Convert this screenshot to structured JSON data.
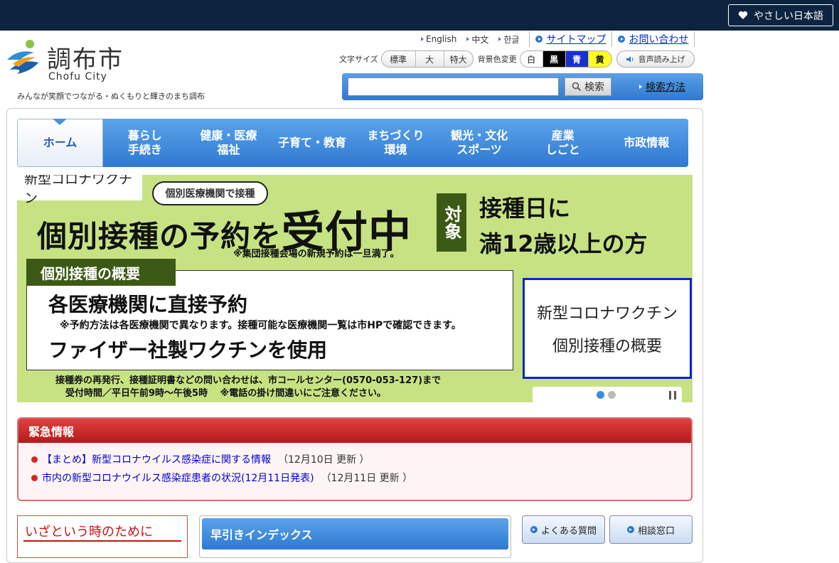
{
  "topbar": {
    "easy_japanese": "やさしい日本語"
  },
  "header": {
    "site_name": "調布市",
    "site_name_en": "Chofu City",
    "tagline": "みんなが笑顔でつながる・ぬくもりと輝きのまち調布",
    "languages": [
      "English",
      "中文",
      "한글"
    ],
    "sitemap": "サイトマップ",
    "contact": "お問い合わせ",
    "font_size_label": "文字サイズ",
    "font_sizes": [
      "標準",
      "大",
      "特大"
    ],
    "bg_color_label": "背景色変更",
    "bg_colors": [
      {
        "label": "白",
        "bg": "#ffffff",
        "fg": "#111111"
      },
      {
        "label": "黒",
        "bg": "#000000",
        "fg": "#ffffff"
      },
      {
        "label": "青",
        "bg": "#1a2fd0",
        "fg": "#ffffff"
      },
      {
        "label": "黄",
        "bg": "#ffff22",
        "fg": "#111111"
      }
    ],
    "voice": "音声読み上げ",
    "search_button": "検索",
    "search_help": "検索方法",
    "search_value": ""
  },
  "nav": [
    "ホーム",
    "暮らし\n手続き",
    "健康・医療\n福祉",
    "子育て・教育",
    "まちづくり\n環境",
    "観光・文化\nスポーツ",
    "産業\nしごと",
    "市政情報"
  ],
  "banner": {
    "tag": "新型コロナワクチン",
    "bubble": "個別医療機関で接種",
    "main_1": "個別接種の予約を",
    "main_2": "受付中",
    "note": "※集団接種会場の新規予約は一旦満了。",
    "target_label": "対象",
    "target_line1": "接種日に",
    "target_line2": "満12歳以上の方",
    "section_title": "個別接種の概要",
    "box_line1": "各医療機関に直接予約",
    "box_line2": "※予約方法は各医療機関で異なります。接種可能な医療機関一覧は市HPで確認できます。",
    "box_line3": "ファイザー社製ワクチンを使用",
    "foot_line1": "接種券の再発行、接種証明書などの問い合わせは、市コールセンター(0570-053-127)まで",
    "foot_line2": "受付時間／平日午前9時～午後5時　 ※電話の掛け間違いにご注意ください。",
    "side_line1": "新型コロナワクチン",
    "side_line2": "個別接種の概要",
    "slides": 2,
    "active_slide": 1
  },
  "emergency": {
    "title": "緊急情報",
    "items": [
      {
        "text": "【まとめ】新型コロナウイルス感染症に関する情報",
        "date": "（12月10日 更新 ）"
      },
      {
        "text": "市内の新型コロナウイルス感染症患者の状況(12月11日発表)",
        "date": "（12月11日 更新 ）"
      }
    ]
  },
  "bottom": {
    "emergency_prep": "いざという時のために",
    "quick_index": "早引きインデックス",
    "faq": "よくある質問",
    "consult": "相談窓口"
  }
}
